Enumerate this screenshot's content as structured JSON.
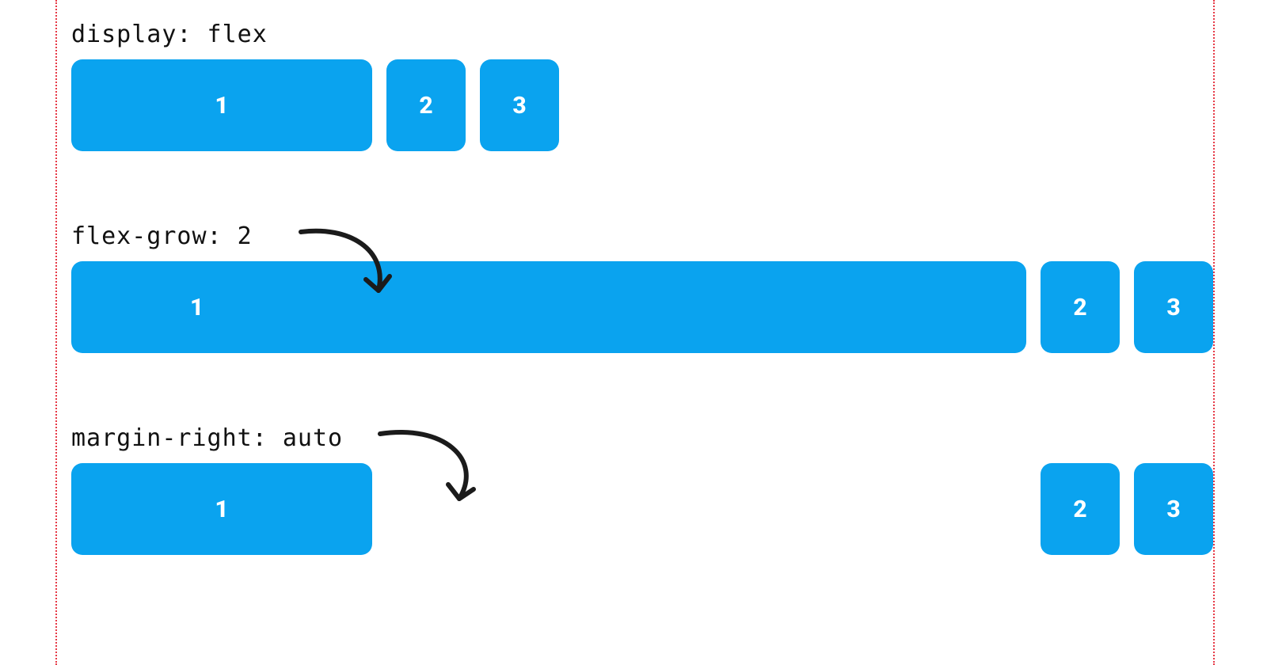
{
  "colors": {
    "box_bg": "#0aa3ef",
    "box_text": "#ffffff",
    "guide": "#e63946",
    "arrow": "#1b1b1b"
  },
  "examples": [
    {
      "label": "display: flex",
      "items": [
        "1",
        "2",
        "3"
      ],
      "mode": "plain"
    },
    {
      "label": "flex-grow: 2",
      "items": [
        "1",
        "2",
        "3"
      ],
      "mode": "grow"
    },
    {
      "label": "margin-right: auto",
      "items": [
        "1",
        "2",
        "3"
      ],
      "mode": "mrauto"
    }
  ]
}
